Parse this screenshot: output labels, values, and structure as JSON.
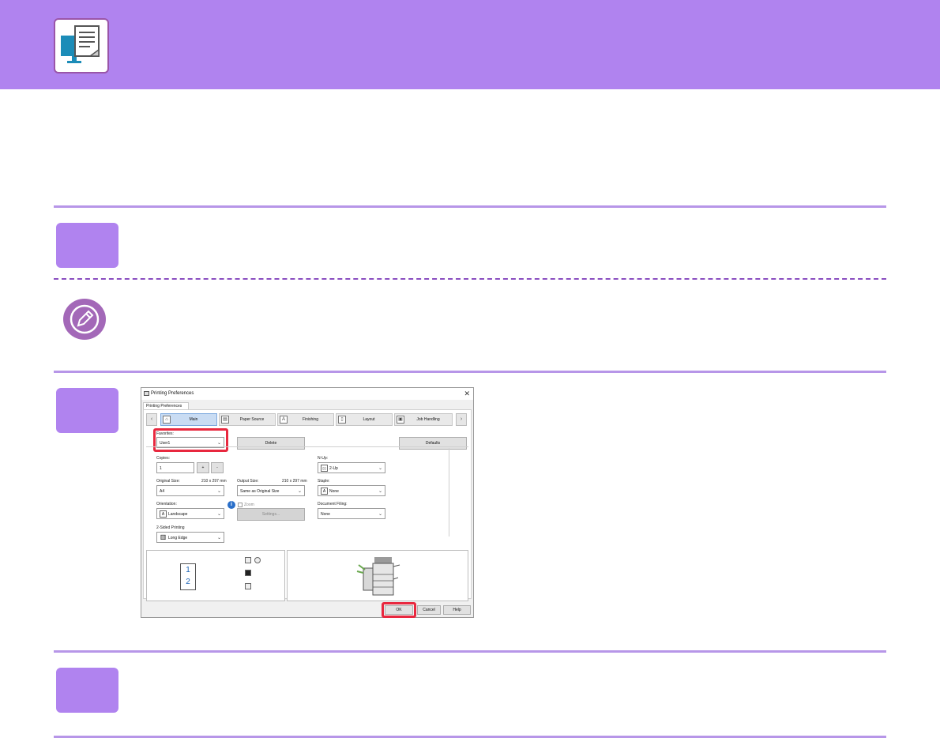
{
  "header": {
    "icon": "computer-document-icon",
    "brand_color": "#b083ef"
  },
  "steps": [
    {
      "icon": "step-box"
    },
    {
      "icon": "step-box"
    },
    {
      "icon": "step-box"
    }
  ],
  "note": {
    "icon": "pencil-icon"
  },
  "dialog": {
    "title": "Printing Preferences",
    "tab_strip_label": "Printing Preferences",
    "tabs": [
      "Main",
      "Paper Source",
      "Finishing",
      "Layout",
      "Job Handling"
    ],
    "favorites": {
      "label": "Favorites:",
      "value": "User1"
    },
    "delete_label": "Delete",
    "defaults_label": "Defaults",
    "copies": {
      "label": "Copies:",
      "value": "1",
      "plus": "+",
      "minus": "-"
    },
    "original_size": {
      "label": "Original Size:",
      "dims": "210 x 297 mm",
      "value": "A4"
    },
    "output_size": {
      "label": "Output Size:",
      "dims": "210 x 297 mm",
      "value": "Same as Original Size"
    },
    "orientation": {
      "label": "Orientation:",
      "value": "Landscape"
    },
    "zoom": {
      "label": "Zoom",
      "settings_label": "Settings..."
    },
    "two_sided": {
      "label": "2-Sided Printing",
      "value": "Long Edge"
    },
    "n_up": {
      "label": "N-Up:",
      "value": "2-Up"
    },
    "staple": {
      "label": "Staple:",
      "value": "None"
    },
    "document_filing": {
      "label": "Document Filing:",
      "value": "None"
    },
    "preview_page_1": "1",
    "preview_page_2": "2",
    "ok_label": "OK",
    "cancel_label": "Cancel",
    "help_label": "Help",
    "highlight_color": "#e8283f"
  }
}
